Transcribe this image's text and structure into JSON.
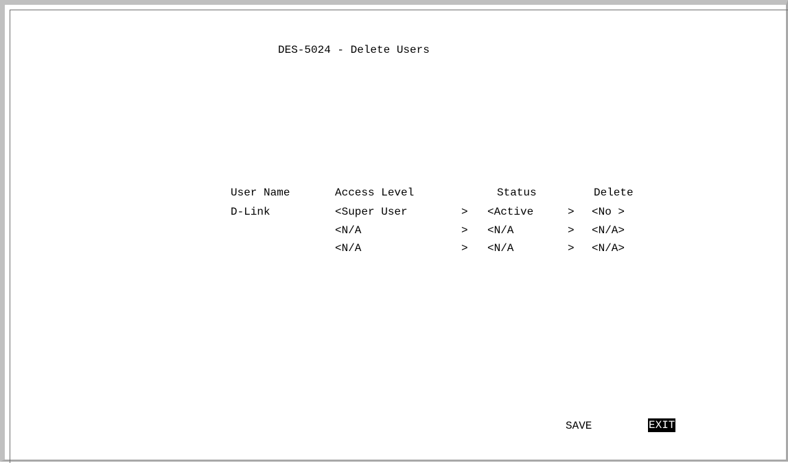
{
  "screen": {
    "title": "DES-5024 - Delete Users"
  },
  "table": {
    "headers": {
      "user_name": "User Name",
      "access_level": "Access Level",
      "status": "Status",
      "delete": "Delete"
    },
    "rows": [
      {
        "user_name": "D-Link",
        "access_level": "<Super User",
        "access_arrow": ">",
        "status": "<Active",
        "status_arrow": ">",
        "delete": "<No >"
      },
      {
        "user_name": "",
        "access_level": "<N/A",
        "access_arrow": ">",
        "status": "<N/A",
        "status_arrow": ">",
        "delete": "<N/A>"
      },
      {
        "user_name": "",
        "access_level": "<N/A",
        "access_arrow": ">",
        "status": "<N/A",
        "status_arrow": ">",
        "delete": "<N/A>"
      }
    ]
  },
  "actions": {
    "save_label": "SAVE",
    "exit_label": "EXIT",
    "selected": "EXIT"
  }
}
